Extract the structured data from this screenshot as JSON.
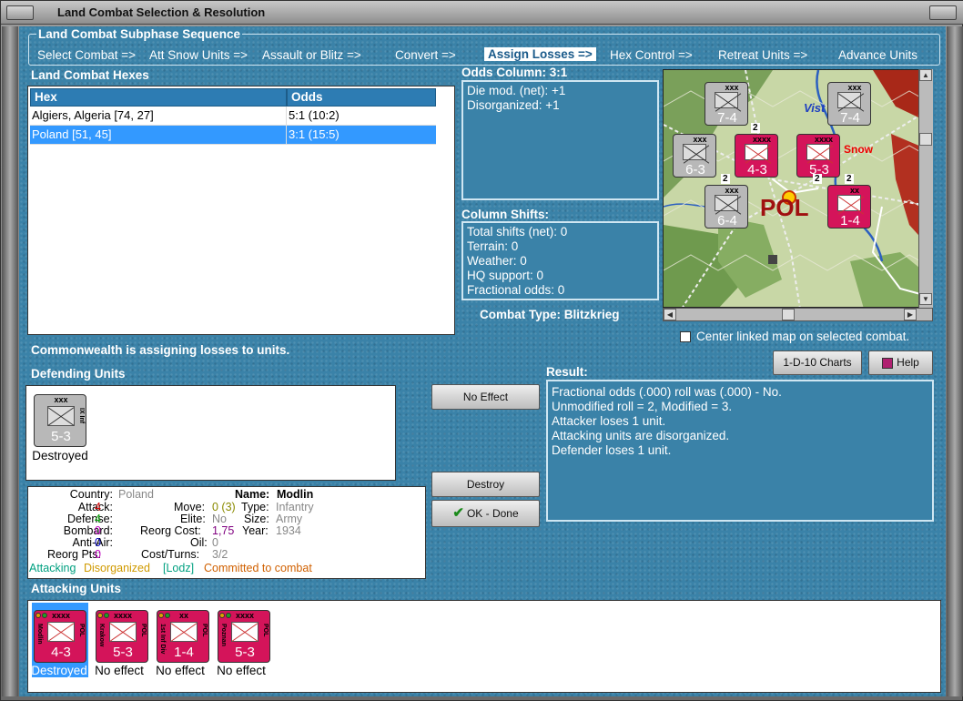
{
  "window": {
    "title": "Land Combat Selection & Resolution"
  },
  "subphase": {
    "title": "Land Combat Subphase Sequence",
    "steps": [
      {
        "label": "Select Combat =>"
      },
      {
        "label": "Att Snow Units =>"
      },
      {
        "label": "Assault or Blitz =>"
      },
      {
        "label": "Convert =>"
      },
      {
        "label": "Assign Losses =>",
        "active": true
      },
      {
        "label": "Hex Control =>"
      },
      {
        "label": "Retreat Units =>"
      },
      {
        "label": "Advance Units"
      }
    ]
  },
  "hexes": {
    "title": "Land Combat Hexes",
    "columns": [
      "Hex",
      "Odds"
    ],
    "rows": [
      {
        "hex": "Algiers, Algeria [74, 27]",
        "odds": "5:1 (10:2)"
      },
      {
        "hex": "Poland [51, 45]",
        "odds": "3:1 (15:5)",
        "selected": true
      }
    ]
  },
  "odds": {
    "title": "Odds Column: 3:1",
    "lines": [
      "Die mod. (net): +1",
      "Disorganized: +1"
    ]
  },
  "shifts": {
    "title": "Column Shifts:",
    "lines": [
      "Total shifts (net): 0",
      "Terrain: 0",
      "Weather: 0",
      "HQ support: 0",
      "Fractional odds: 0"
    ]
  },
  "combat_type": "Combat Type:  Blitzkrieg",
  "center_map_label": "Center linked map on selected combat.",
  "status_message": "Commonwealth is assigning losses to units.",
  "buttons": {
    "charts": "1-D-10 Charts",
    "help": "Help",
    "no_effect": "No Effect",
    "destroy": "Destroy",
    "ok_done": "OK - Done"
  },
  "defending": {
    "title": "Defending Units",
    "units": [
      {
        "strength": "5-3",
        "size": "xxx",
        "side": "IX Inf",
        "status": "Destroyed"
      }
    ]
  },
  "result": {
    "title": "Result:",
    "lines": [
      "Fractional odds (.000) roll was (.000)  - No.",
      "Unmodified roll = 2, Modified = 3.",
      "Attacker loses 1 unit.",
      "Attacking units are disorganized.",
      "Defender loses 1 unit."
    ]
  },
  "unit_details": {
    "country_label": "Country:",
    "country": "Poland",
    "attack_label": "Attack:",
    "attack": "4",
    "defense_label": "Defense:",
    "defense": "4",
    "bombard_label": "Bombard:",
    "bombard": "0",
    "antiair_label": "Anti-Air:",
    "antiair": "0",
    "reorg_label": "Reorg Pts:",
    "reorg": "0",
    "name_label": "Name:",
    "name": "Modlin",
    "move_label": "Move:",
    "move": "0 (3)",
    "type_label": "Type:",
    "type": "Infantry",
    "elite_label": "Elite:",
    "elite": "No",
    "size_label": "Size:",
    "size": "Army",
    "reorg_cost_label": "Reorg Cost:",
    "reorg_cost": "1,75",
    "year_label": "Year:",
    "year": "1934",
    "oil_label": "Oil:",
    "oil": "0",
    "cost_label": "Cost/Turns:",
    "cost": "3/2",
    "flags": [
      "Attacking",
      "Disorganized",
      "[Lodz]",
      "Committed to combat"
    ]
  },
  "attacking": {
    "title": "Attacking Units",
    "units": [
      {
        "strength": "4-3",
        "size": "xxxx",
        "side": "Modlin",
        "nat": "POL",
        "status": "Destroyed",
        "selected": true
      },
      {
        "strength": "5-3",
        "size": "xxxx",
        "side": "Krakow",
        "nat": "POL",
        "status": "No effect"
      },
      {
        "strength": "1-4",
        "size": "xx",
        "side": "1st Inf Div",
        "nat": "POL",
        "status": "No effect"
      },
      {
        "strength": "5-3",
        "size": "xxxx",
        "side": "Poznan",
        "nat": "POL",
        "status": "No effect"
      }
    ]
  },
  "map": {
    "label_vist": "Vist",
    "label_snow": "Snow",
    "label_pol": "POL",
    "counters": [
      {
        "strength": "7-4",
        "size": "xxx",
        "color": "gray"
      },
      {
        "strength": "7-4",
        "size": "xxx",
        "color": "gray"
      },
      {
        "strength": "6-3",
        "size": "xxx",
        "color": "gray"
      },
      {
        "strength": "4-3",
        "size": "xxxx",
        "color": "pink"
      },
      {
        "strength": "5-3",
        "size": "xxxx",
        "color": "pink"
      },
      {
        "strength": "6-4",
        "size": "xxx",
        "color": "gray"
      },
      {
        "strength": "1-4",
        "size": "xx",
        "color": "pink"
      }
    ],
    "stack_counts": [
      "2",
      "2",
      "2",
      "2"
    ]
  },
  "colors": {
    "panel_blue": "#3a82a8",
    "select_blue": "#3399ff",
    "unit_pink": "#d4145a",
    "attack_red": "#d40000",
    "defense_green": "#00a000",
    "bombard_magenta": "#c000c0",
    "antiair_blue": "#0000c0"
  }
}
